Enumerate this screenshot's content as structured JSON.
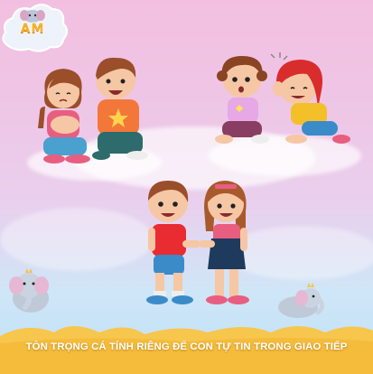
{
  "logo": {
    "text": "AM",
    "icon": "elephant-icon"
  },
  "caption": "TÔN TRỌNG CÁ TÍNH RIÊNG ĐỂ CON TỰ TIN TRONG GIAO TIẾP",
  "colors": {
    "sky_pink": "#f3bfe0",
    "sky_blue": "#bfe0f8",
    "banner": "#f7c64d",
    "logo_text": "#f6b333"
  },
  "scenes": [
    {
      "name": "comforting-friends",
      "icon": "children-comforting-icon"
    },
    {
      "name": "whispering-friends",
      "icon": "children-whispering-icon"
    },
    {
      "name": "handshake-friends",
      "icon": "children-handshake-icon"
    }
  ],
  "decorations": [
    "elephant-icon",
    "elephant-icon"
  ]
}
